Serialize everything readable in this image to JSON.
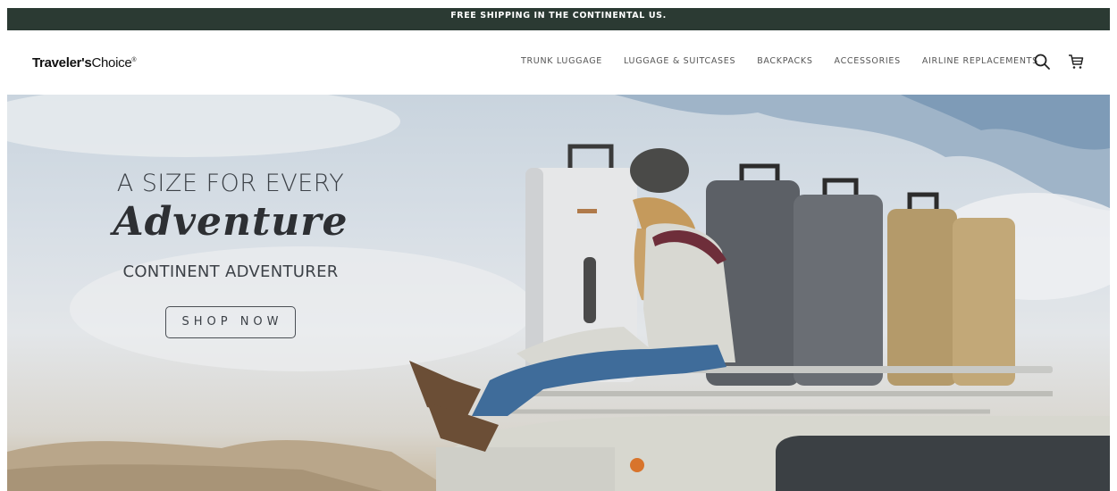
{
  "announcement": "FREE SHIPPING IN THE CONTINENTAL US.",
  "brand": {
    "bold": "Traveler's",
    "regular": "Choice",
    "mark": "®"
  },
  "nav": {
    "items": [
      {
        "label": "TRUNK LUGGAGE"
      },
      {
        "label": "LUGGAGE & SUITCASES"
      },
      {
        "label": "BACKPACKS"
      },
      {
        "label": "ACCESSORIES"
      },
      {
        "label": "AIRLINE REPLACEMENTS"
      }
    ],
    "search_icon": "search-icon",
    "cart_icon": "cart-icon"
  },
  "hero": {
    "kicker": "A SIZE FOR EVERY",
    "script": "Adventure",
    "subtitle": "CONTINENT ADVENTURER",
    "cta": "SHOP NOW"
  },
  "colors": {
    "announcement_bg": "#2b3a33",
    "text_dark": "#3c4147",
    "nav_text": "#555555"
  }
}
